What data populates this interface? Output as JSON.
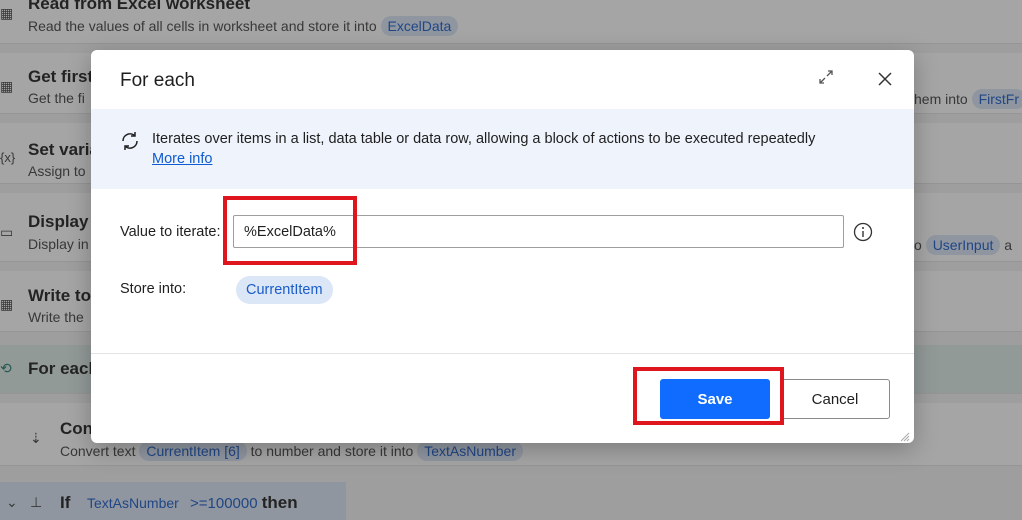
{
  "flow": {
    "steps": [
      {
        "title": "Read from Excel worksheet",
        "desc_prefix": "Read the values of all cells in worksheet and store it into",
        "var": "ExcelData"
      },
      {
        "title": "Get first",
        "desc_prefix": "Get the fi",
        "right_text": "hem into",
        "right_var": "FirstFr"
      },
      {
        "title": "Set varia",
        "desc_prefix": "Assign to",
        "icon": "{x}"
      },
      {
        "title": "Display",
        "desc_prefix": "Display in",
        "right_text": "o",
        "right_var": "UserInput",
        "right_tail": "a"
      },
      {
        "title": "Write to",
        "desc_prefix": "Write the"
      },
      {
        "title": "For each"
      },
      {
        "title": "Conv",
        "desc_prefix": "Convert text",
        "var": "CurrentItem",
        "index": "[6]",
        "desc_mid": "to number and store it into",
        "var2": "TextAsNumber"
      },
      {
        "title": "If",
        "var": "TextAsNumber",
        "op": ">=100000",
        "tail": "then"
      }
    ]
  },
  "dialog": {
    "title": "For each",
    "info_text": "Iterates over items in a list, data table or data row, allowing a block of actions to be executed repeatedly",
    "more_info": "More info",
    "value_label": "Value to iterate:",
    "value": "%ExcelData%",
    "store_label": "Store into:",
    "store_var": "CurrentItem",
    "save_label": "Save",
    "cancel_label": "Cancel"
  },
  "colors": {
    "accent": "#0f6cff",
    "highlight_box": "#e0161f",
    "chip_bg": "#dbe6f6"
  }
}
